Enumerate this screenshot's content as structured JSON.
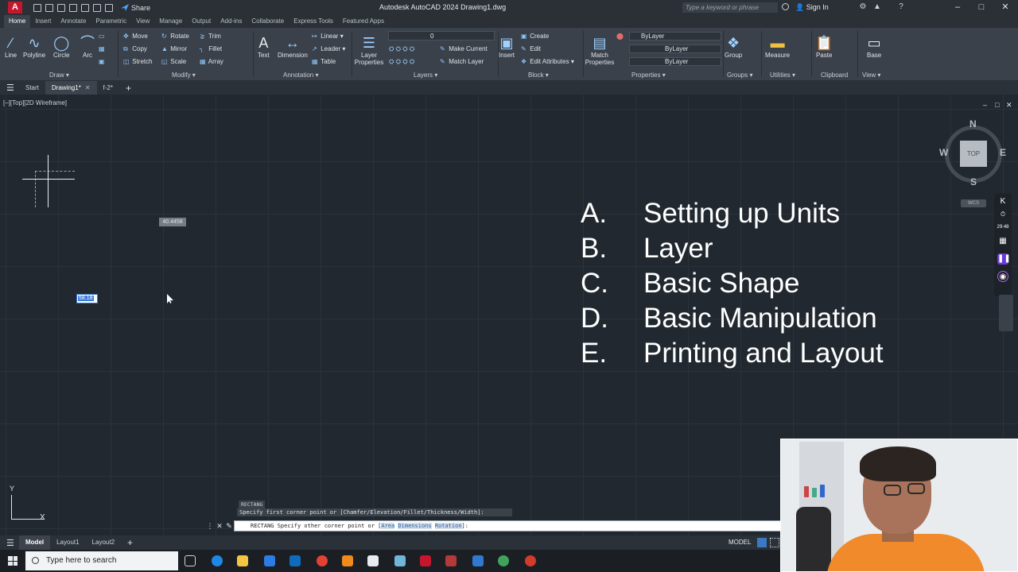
{
  "titlebar": {
    "share_label": "Share",
    "title": "Autodesk AutoCAD 2024   Drawing1.dwg",
    "search_placeholder": "Type a keyword or phrase",
    "signin_label": "Sign In"
  },
  "ribbon_tabs": [
    "Home",
    "Insert",
    "Annotate",
    "Parametric",
    "View",
    "Manage",
    "Output",
    "Add-ins",
    "Collaborate",
    "Express Tools",
    "Featured Apps"
  ],
  "ribbon": {
    "draw": {
      "label": "Draw",
      "line": "Line",
      "polyline": "Polyline",
      "circle": "Circle",
      "arc": "Arc"
    },
    "modify": {
      "label": "Modify",
      "move": "Move",
      "rotate": "Rotate",
      "trim": "Trim",
      "copy": "Copy",
      "mirror": "Mirror",
      "fillet": "Fillet",
      "stretch": "Stretch",
      "scale": "Scale",
      "array": "Array"
    },
    "annotation": {
      "label": "Annotation",
      "text": "Text",
      "dimension": "Dimension",
      "linear": "Linear",
      "leader": "Leader",
      "table": "Table"
    },
    "layers": {
      "label": "Layers",
      "layer_properties": "Layer Properties",
      "current_layer": "0",
      "make_current": "Make Current",
      "match_layer": "Match Layer"
    },
    "block": {
      "label": "Block",
      "insert": "Insert",
      "create": "Create",
      "edit": "Edit",
      "edit_attributes": "Edit Attributes"
    },
    "properties": {
      "label": "Properties",
      "match_properties": "Match Properties",
      "color": "ByLayer",
      "linetype": "ByLayer",
      "lineweight": "ByLayer"
    },
    "groups": {
      "label": "Groups",
      "group": "Group"
    },
    "utilities": {
      "label": "Utilities",
      "measure": "Measure"
    },
    "clipboard": {
      "label": "Clipboard",
      "paste": "Paste"
    },
    "view": {
      "label": "View",
      "base": "Base"
    }
  },
  "doc_tabs": {
    "start": "Start",
    "drawing": "Drawing1*",
    "other": "f-2*"
  },
  "viewport": {
    "label": "[–][Top][2D Wireframe]",
    "dyn_input_1": "40.4458",
    "dyn_input_2": "58.18",
    "viewcube": {
      "top": "TOP",
      "n": "N",
      "s": "S",
      "e": "E",
      "w": "W",
      "wcs": "WCS"
    },
    "ucs_x": "X",
    "ucs_y": "Y"
  },
  "outline": [
    {
      "letter": "A.",
      "text": "Setting up Units"
    },
    {
      "letter": "B.",
      "text": "Layer"
    },
    {
      "letter": "C.",
      "text": "Basic Shape"
    },
    {
      "letter": "D.",
      "text": "Basic Manipulation"
    },
    {
      "letter": "E.",
      "text": "Printing and Layout"
    }
  ],
  "recorder": {
    "time": "29:48"
  },
  "command": {
    "history_1": "RECTANG",
    "history_2": "Specify first corner point or [Chamfer/Elevation/Fillet/Thickness/Width]:",
    "prompt_prefix": "RECTANG Specify other corner point or [",
    "opt_area": "Area",
    "opt_dimensions": "Dimensions",
    "opt_rotation": "Rotation",
    "prompt_suffix": "]:"
  },
  "layout_tabs": [
    "Model",
    "Layout1",
    "Layout2"
  ],
  "status": {
    "model": "MODEL"
  },
  "taskbar": {
    "search_placeholder": "Type here to search"
  }
}
